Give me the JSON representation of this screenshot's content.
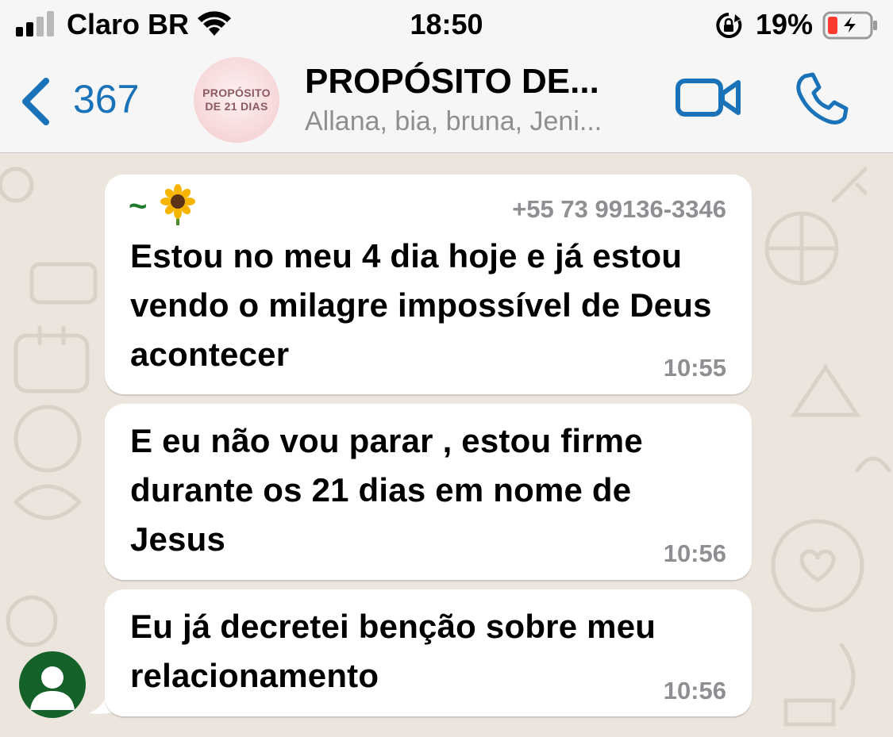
{
  "status_bar": {
    "carrier": "Claro BR",
    "time": "18:50",
    "battery_percent": "19%",
    "battery_level": 0.19,
    "battery_charging": true,
    "icons": [
      "signal-icon",
      "wifi-icon",
      "orientation-lock-icon",
      "battery-icon"
    ]
  },
  "header": {
    "back_count": "367",
    "avatar_text_line1": "PROPÓSITO",
    "avatar_text_line2": "DE 21 DIAS",
    "title": "PROPÓSITO DE...",
    "members": "Allana, bia, bruna, Jeni...",
    "accent_color": "#1A73B8",
    "icons": [
      "chevron-left-icon",
      "video-call-icon",
      "phone-call-icon"
    ]
  },
  "messages": [
    {
      "sender_name": "~",
      "sender_emoji_icon": "sunflower-icon",
      "sender_phone": "+55 73 99136-3346",
      "text": "Estou no meu 4 dia hoje e já estou vendo o milagre impossível de Deus acontecer",
      "time": "10:55"
    },
    {
      "text": "E eu não vou parar , estou firme durante os 21 dias em nome de Jesus",
      "time": "10:56"
    },
    {
      "text": "Eu já decretei benção sobre meu relacionamento",
      "time": "10:56"
    }
  ],
  "colors": {
    "chat_background": "#ECE5DD",
    "bubble": "#FFFFFF",
    "sender_name": "#1E7B2E",
    "sender_avatar": "#14612A"
  }
}
